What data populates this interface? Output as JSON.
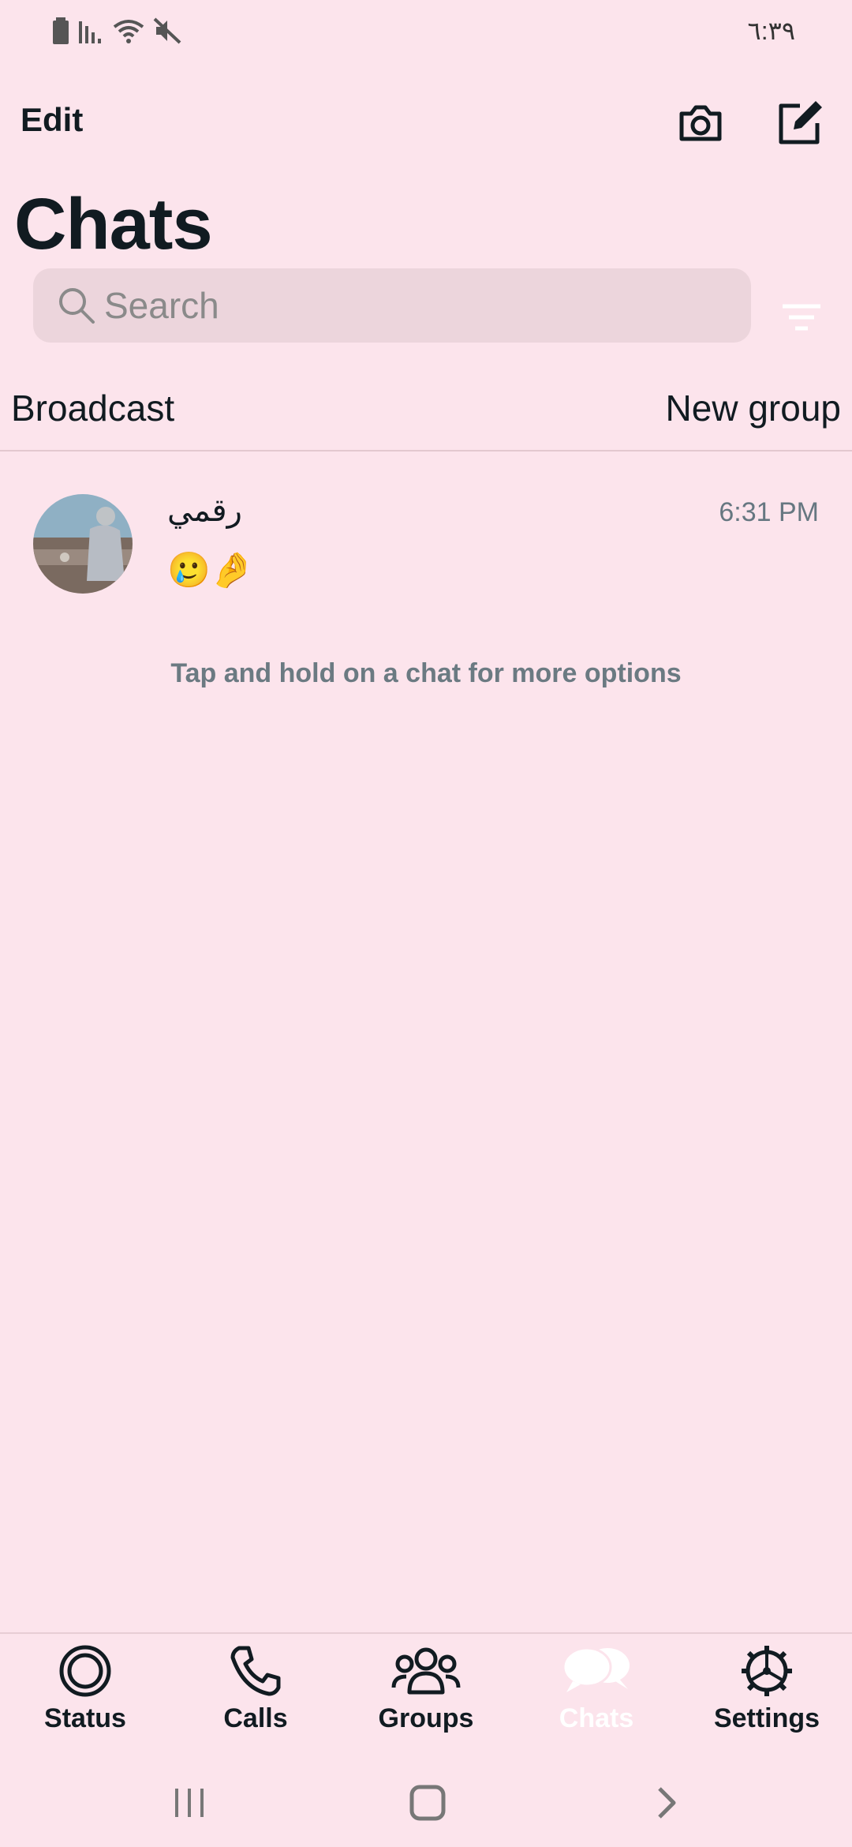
{
  "status_bar": {
    "time": "٦:٣٩",
    "icons": [
      "battery-icon",
      "signal-icon",
      "wifi-icon",
      "mute-icon"
    ]
  },
  "header": {
    "edit_label": "Edit",
    "title": "Chats",
    "icons": [
      "camera-icon",
      "compose-icon"
    ]
  },
  "search": {
    "placeholder": "Search",
    "filter_icon": "filter-icon"
  },
  "actions": {
    "broadcast_label": "Broadcast",
    "new_group_label": "New group"
  },
  "chats": [
    {
      "name": "رقمي",
      "time": "6:31 PM",
      "message": "🥲🤌"
    }
  ],
  "hint": "Tap and hold on a chat for more options",
  "tabs": [
    {
      "label": "Status",
      "icon": "status-icon",
      "active": false
    },
    {
      "label": "Calls",
      "icon": "phone-icon",
      "active": false
    },
    {
      "label": "Groups",
      "icon": "groups-icon",
      "active": false
    },
    {
      "label": "Chats",
      "icon": "chats-icon",
      "active": true
    },
    {
      "label": "Settings",
      "icon": "gear-icon",
      "active": false
    }
  ],
  "nav": [
    "recents-icon",
    "home-icon",
    "back-icon"
  ],
  "colors": {
    "background": "#fce4ec",
    "search_bg": "#ecd5dc",
    "text": "#111b21",
    "muted": "#667781",
    "active_tab": "#ffffff"
  }
}
